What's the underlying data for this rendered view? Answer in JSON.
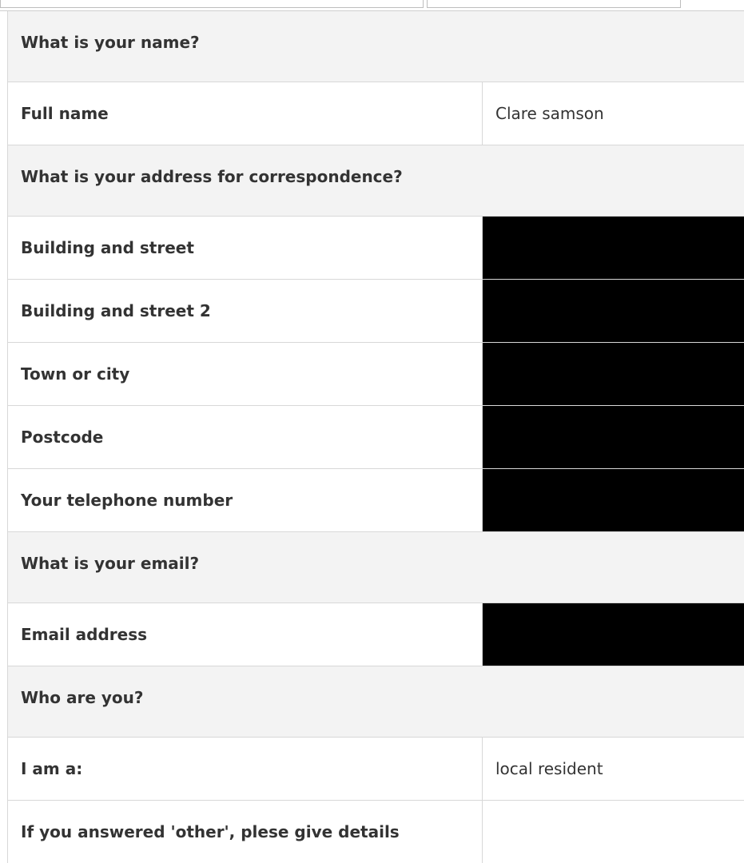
{
  "sections": {
    "name": {
      "title": "What is your name?"
    },
    "address": {
      "title": "What is your address for correspondence?"
    },
    "email": {
      "title": "What is your email?"
    },
    "who": {
      "title": "Who are you?"
    }
  },
  "fields": {
    "full_name": {
      "label": "Full name",
      "value": "Clare samson"
    },
    "building_street": {
      "label": "Building and street",
      "value": ""
    },
    "building_street_2": {
      "label": "Building and street 2",
      "value": ""
    },
    "town_city": {
      "label": "Town or city",
      "value": ""
    },
    "postcode": {
      "label": "Postcode",
      "value": ""
    },
    "telephone": {
      "label": "Your telephone number",
      "value": ""
    },
    "email_address": {
      "label": "Email address",
      "value": ""
    },
    "i_am_a": {
      "label": "I am a:",
      "value": "local resident"
    },
    "other_details": {
      "label": "If you answered 'other', plese give details",
      "value": ""
    }
  },
  "colors": {
    "section_bg": "#f3f3f3",
    "redaction": "#000000",
    "border": "#d8d8d8",
    "text": "#333333"
  }
}
